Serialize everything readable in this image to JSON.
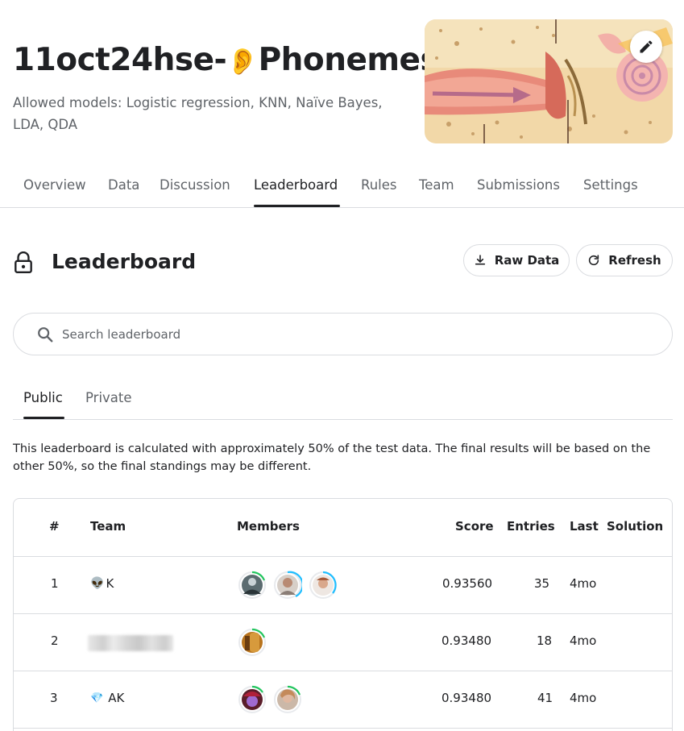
{
  "competition": {
    "title_prefix": "11oct24hse-",
    "title_emoji": "👂",
    "title_suffix": "Phonemes",
    "subtitle": "Allowed models: Logistic regression, KNN, Naïve Bayes, LDA, QDA"
  },
  "nav": {
    "tabs": [
      {
        "label": "Overview"
      },
      {
        "label": "Data"
      },
      {
        "label": "Discussion"
      },
      {
        "label": "Leaderboard"
      },
      {
        "label": "Rules"
      },
      {
        "label": "Team"
      },
      {
        "label": "Submissions"
      },
      {
        "label": "Settings"
      }
    ],
    "active": "Leaderboard"
  },
  "leaderboard": {
    "title": "Leaderboard",
    "raw_data_label": "Raw Data",
    "refresh_label": "Refresh",
    "search_placeholder": "Search leaderboard",
    "subtabs": [
      {
        "label": "Public"
      },
      {
        "label": "Private"
      }
    ],
    "active_subtab": "Public",
    "notice": "This leaderboard is calculated with approximately 50% of the test data. The final results will be based on the other 50%, so the final standings may be different.",
    "columns": {
      "rank": "#",
      "team": "Team",
      "members": "Members",
      "score": "Score",
      "entries": "Entries",
      "last": "Last",
      "solution": "Solution"
    },
    "rows": [
      {
        "rank": "1",
        "team_emoji": "👽",
        "team": "K",
        "members": 3,
        "score": "0.93560",
        "entries": "35",
        "last": "4mo"
      },
      {
        "rank": "2",
        "team_emoji": "",
        "team": "",
        "members": 1,
        "score": "0.93480",
        "entries": "18",
        "last": "4mo"
      },
      {
        "rank": "3",
        "team_emoji": "💎",
        "team": "AK",
        "members": 2,
        "score": "0.93480",
        "entries": "41",
        "last": "4mo"
      }
    ]
  },
  "colors": {
    "accent": "#202124",
    "muted": "#5f6368",
    "border": "#dadce0",
    "ring_green": "#20beff",
    "ring_progress": "#22c55e"
  },
  "icons": {
    "edit": "pencil-icon",
    "lock": "lock-icon",
    "download": "download-icon",
    "refresh": "refresh-icon",
    "search": "search-icon"
  }
}
